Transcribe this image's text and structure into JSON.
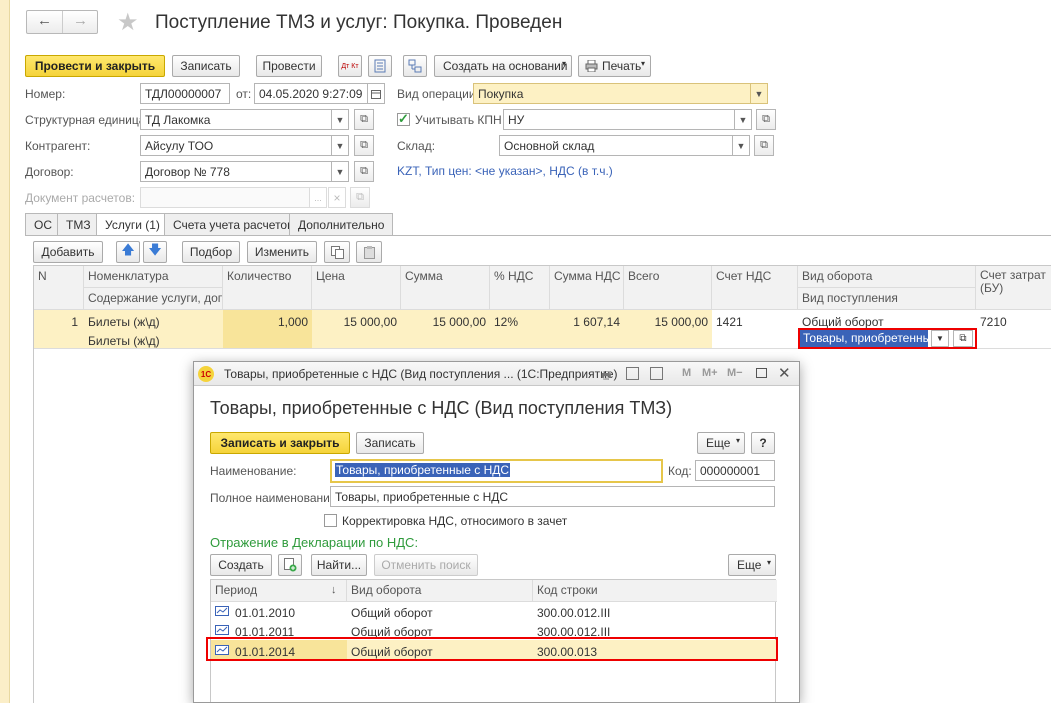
{
  "header": {
    "title": "Поступление ТМЗ и услуг: Покупка. Проведен",
    "back_glyph": "←",
    "forward_glyph": "→",
    "star_glyph": "★"
  },
  "toolbar": {
    "post_close": "Провести и закрыть",
    "save": "Записать",
    "post": "Провести",
    "create_based": "Создать на основании",
    "print": "Печать",
    "dt_kt": "Дт Кт"
  },
  "form": {
    "number_label": "Номер:",
    "number_value": "ТДЛ00000007",
    "date_label": "от:",
    "date_value": "04.05.2020  9:27:09",
    "op_label": "Вид операции:",
    "op_value": "Покупка",
    "unit_label": "Структурная единица:",
    "unit_value": "ТД Лакомка",
    "kpn_label": "Учитывать КПН",
    "kpn_value": "НУ",
    "contractor_label": "Контрагент:",
    "contractor_value": "Айсулу ТОО",
    "warehouse_label": "Склад:",
    "warehouse_value": "Основной склад",
    "contract_label": "Договор:",
    "contract_value": "Договор № 778",
    "price_info": "KZT, Тип цен: <не указан>, НДС (в т.ч.)",
    "settlement_label": "Документ расчетов:",
    "ellipsis": "...",
    "clear": "×"
  },
  "tabs": [
    "ОС",
    "ТМЗ",
    "Услуги (1)",
    "Счета учета расчетов",
    "Дополнительно"
  ],
  "services_toolbar": {
    "add": "Добавить",
    "select": "Подбор",
    "change": "Изменить",
    "up": "🡅",
    "down": "🡇"
  },
  "table": {
    "headers": {
      "n": "N",
      "nom": "Номенклатура",
      "nom2": "Содержание услуги, доп.",
      "qty": "Количество",
      "price": "Цена",
      "sum": "Сумма",
      "vat_pct": "% НДС",
      "vat_sum": "Сумма НДС",
      "total": "Всего",
      "vat_acc": "Счет НДС",
      "turnover": "Вид оборота",
      "receipt": "Вид поступления",
      "cost_acc": "Счет затрат (БУ)"
    },
    "row": {
      "n": "1",
      "nom": "Билеты (ж\\д)",
      "nom2": "Билеты (ж\\д)",
      "qty": "1,000",
      "price": "15 000,00",
      "sum": "15 000,00",
      "vat_pct": "12%",
      "vat_sum": "1 607,14",
      "total": "15 000,00",
      "vat_acc": "1421",
      "turnover": "Общий оборот",
      "receipt": "Товары, приобретенные",
      "cost_acc": "7210"
    }
  },
  "dialog": {
    "window_title": "Товары, приобретенные с НДС (Вид поступления ... (1С:Предприятие)",
    "logo": "1С",
    "heading": "Товары, приобретенные с НДС (Вид поступления ТМЗ)",
    "save_close": "Записать и закрыть",
    "save": "Записать",
    "more": "Еще",
    "help": "?",
    "name_label": "Наименование:",
    "name_value": "Товары, приобретенные с НДС",
    "code_label": "Код:",
    "code_value": "000000001",
    "fullname_label": "Полное наименование:",
    "fullname_value": "Товары, приобретенные с НДС",
    "vat_correction": "Корректировка НДС, относимого в зачет",
    "section": "Отражение в Декларации по НДС:",
    "create": "Создать",
    "find": "Найти...",
    "cancel_find": "Отменить поиск",
    "more2": "Еще",
    "win_m": "M",
    "win_mplus": "M+",
    "win_mminus": "M−",
    "columns": {
      "period": "Период",
      "turnover": "Вид оборота",
      "code": "Код строки",
      "sort": "↓"
    },
    "rows": [
      {
        "period": "01.01.2010",
        "turnover": "Общий оборот",
        "code": "300.00.012.III"
      },
      {
        "period": "01.01.2011",
        "turnover": "Общий оборот",
        "code": "300.00.012.III"
      },
      {
        "period": "01.01.2014",
        "turnover": "Общий оборот",
        "code": "300.00.013"
      }
    ]
  },
  "colors": {
    "accent_yellow": "#f5d33a",
    "highlight_row": "#fdf1c4",
    "red_frame": "#e00000",
    "green_text": "#2f9b3c",
    "link_blue": "#3a63b8"
  }
}
